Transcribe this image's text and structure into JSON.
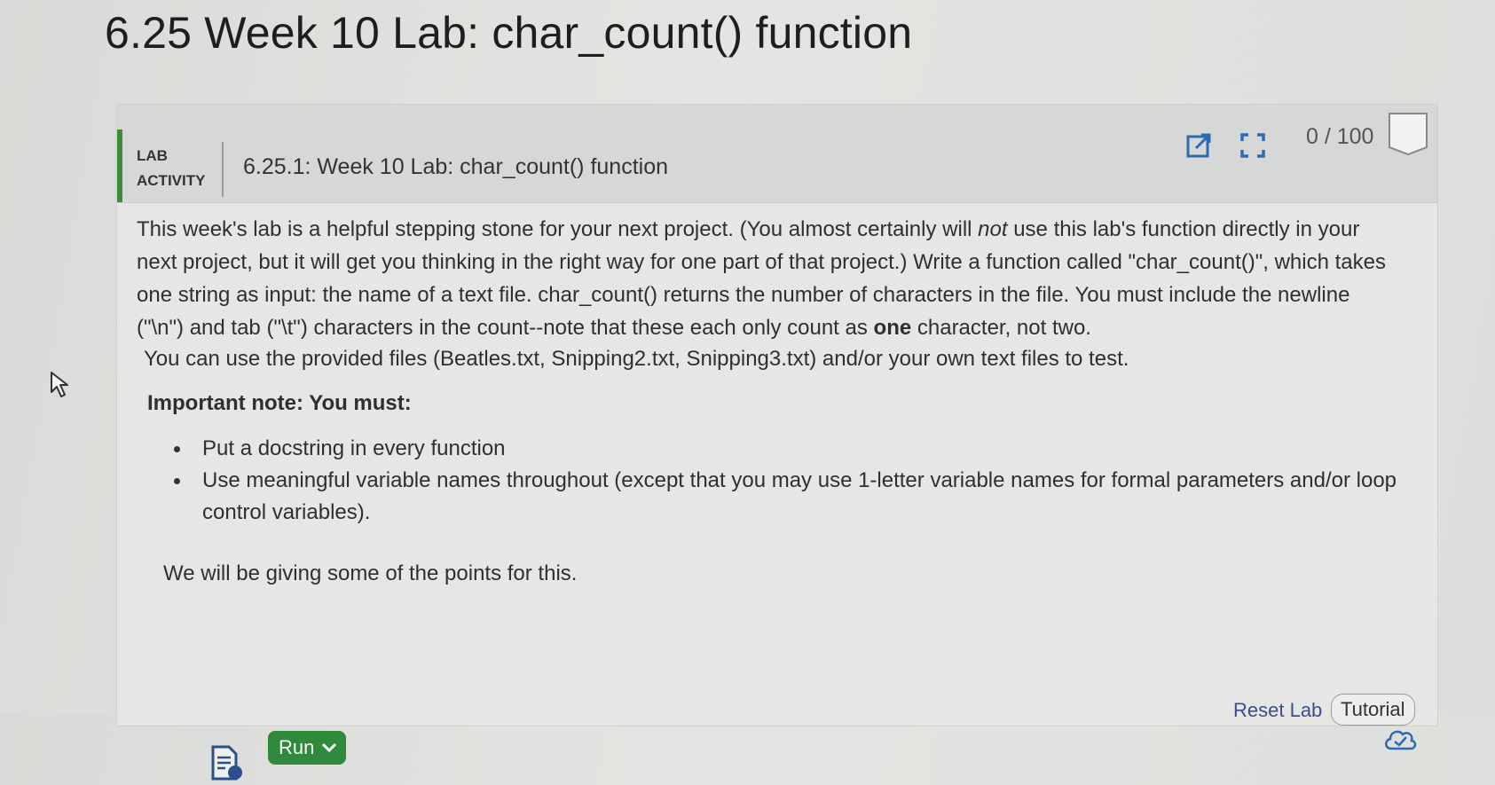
{
  "page": {
    "title": "6.25 Week 10 Lab: char_count() function"
  },
  "lab": {
    "type_line1": "LAB",
    "type_line2": "ACTIVITY",
    "name": "6.25.1: Week 10 Lab: char_count() function",
    "score": "0 / 100"
  },
  "instructions": {
    "p1_a": "This week's lab is a helpful stepping stone for your next project. (You almost certainly will ",
    "p1_not": "not",
    "p1_b": " use this lab's function directly in your next project, but it will get you thinking in the right way for one part of that project.) Write a function called \"char_count()\", which takes one string as input: the name of a text file. char_count() returns the number of characters in the file. You must include the newline (\"\\n\") and tab (\"\\t\") characters in the count--note that these each only count as ",
    "p1_one": "one",
    "p1_c": " character, not two.",
    "p2": "You can use the provided files (Beatles.txt, Snipping2.txt, Snipping3.txt) and/or your own text files to test.",
    "important": "Important note: You must:",
    "bullets": [
      "Put a docstring in every function",
      "Use meaningful variable names throughout (except that you may use 1-letter variable names for formal parameters and/or loop control variables)."
    ],
    "p4": "We will be giving some of the points for this."
  },
  "actions": {
    "reset_lab": "Reset Lab",
    "tutorial": "Tutorial",
    "run": "Run"
  },
  "colors": {
    "accent_green": "#2f8a3b",
    "link_blue": "#3a4f8a"
  },
  "icons": [
    "open-external-icon",
    "fullscreen-icon",
    "completion-box-icon",
    "cloud-check-icon",
    "file-icon",
    "chevron-down-icon",
    "mouse-cursor-icon"
  ]
}
